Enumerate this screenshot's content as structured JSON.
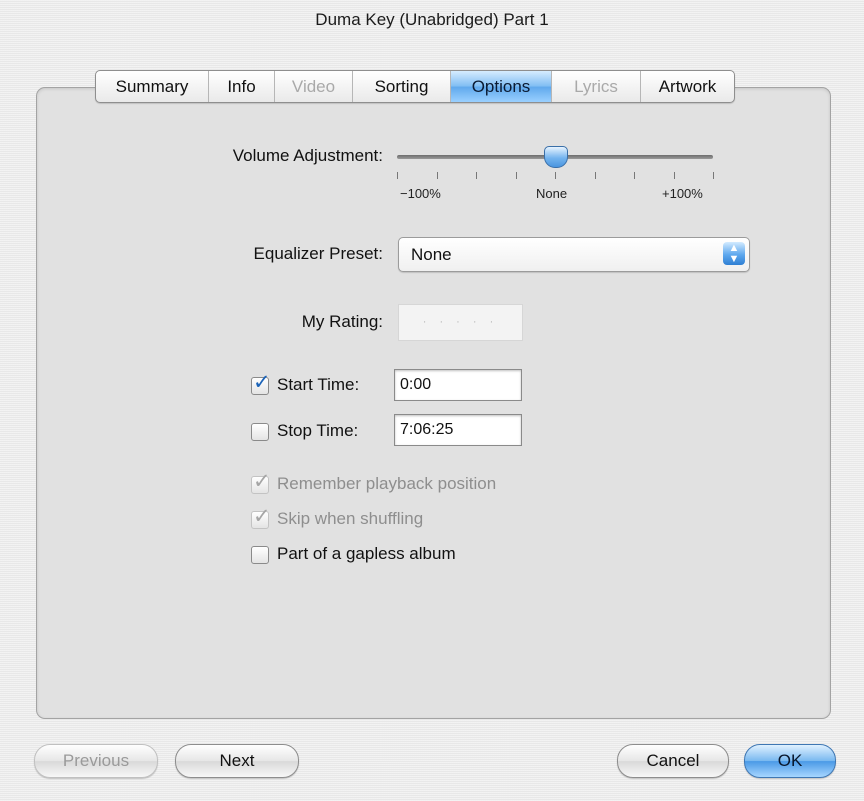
{
  "window": {
    "title": "Duma Key (Unabridged) Part 1"
  },
  "tabs": [
    {
      "label": "Summary",
      "state": "normal"
    },
    {
      "label": "Info",
      "state": "normal"
    },
    {
      "label": "Video",
      "state": "disabled"
    },
    {
      "label": "Sorting",
      "state": "normal"
    },
    {
      "label": "Options",
      "state": "selected"
    },
    {
      "label": "Lyrics",
      "state": "disabled"
    },
    {
      "label": "Artwork",
      "state": "normal"
    }
  ],
  "volume": {
    "label": "Volume Adjustment:",
    "value_percent": 0,
    "min_label": "−100%",
    "mid_label": "None",
    "max_label": "+100%"
  },
  "equalizer": {
    "label": "Equalizer Preset:",
    "selected": "None",
    "arrows_icon": "popup-updown-arrows-icon"
  },
  "rating": {
    "label": "My Rating:",
    "stars": 0,
    "dots": "· · · · ·"
  },
  "start_time": {
    "label": "Start Time:",
    "value": "0:00",
    "checked": true
  },
  "stop_time": {
    "label": "Stop Time:",
    "value": "7:06:25",
    "checked": false
  },
  "options": {
    "remember_playback": {
      "label": "Remember playback position",
      "checked": true,
      "enabled": false
    },
    "skip_shuffling": {
      "label": "Skip when shuffling",
      "checked": true,
      "enabled": false
    },
    "gapless": {
      "label": "Part of a gapless album",
      "checked": false,
      "enabled": true
    }
  },
  "buttons": {
    "previous": "Previous",
    "next": "Next",
    "cancel": "Cancel",
    "ok": "OK"
  },
  "colors": {
    "accent": "#5fa8ec",
    "checkmark": "#1b63b8"
  }
}
